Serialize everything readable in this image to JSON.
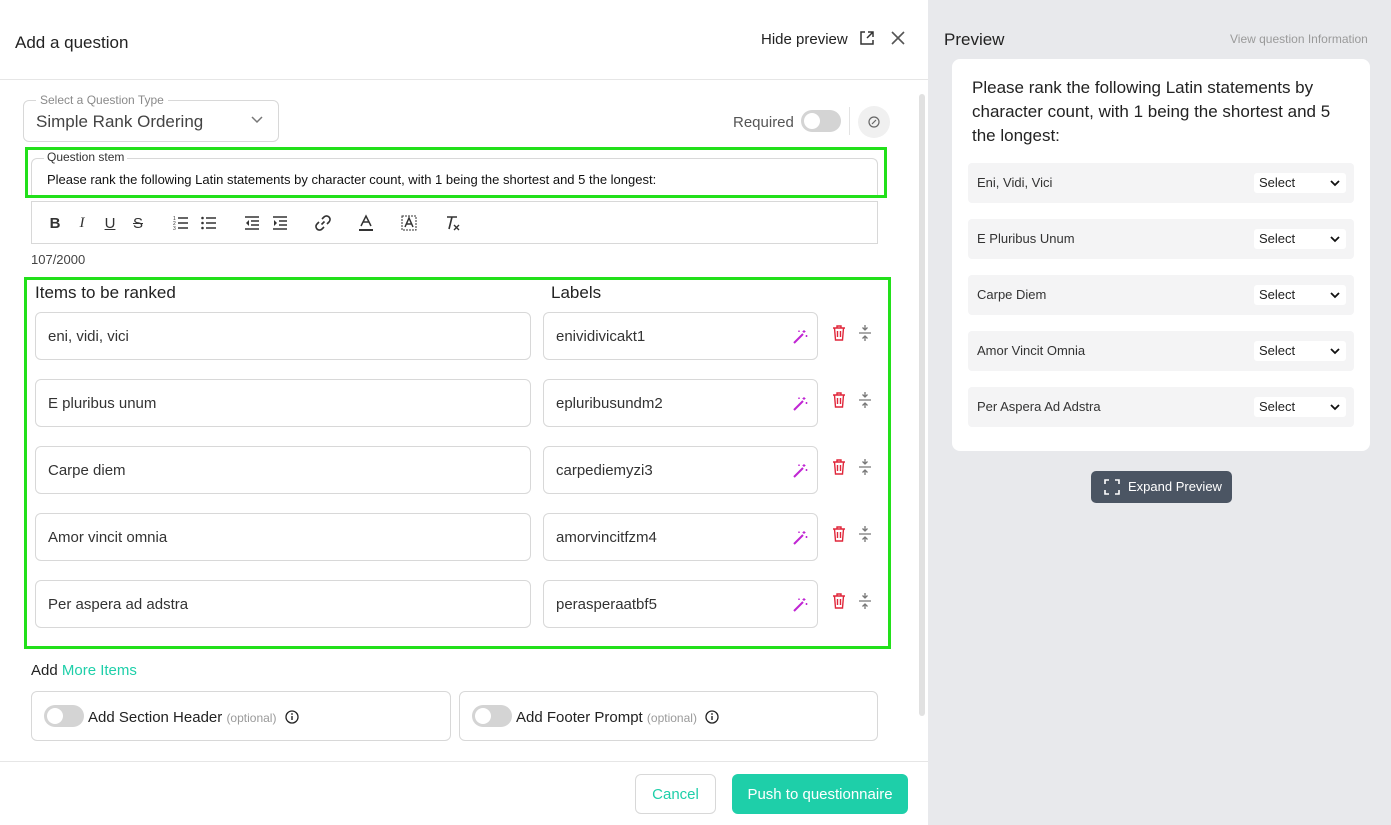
{
  "header": {
    "title": "Add a question",
    "hide_preview": "Hide preview"
  },
  "question_type": {
    "legend": "Select a Question Type",
    "value": "Simple Rank Ordering"
  },
  "required": {
    "label": "Required",
    "enabled": false
  },
  "stem": {
    "legend": "Question stem",
    "text": "Please rank the following Latin statements by character count, with 1 being the shortest and 5 the longest:",
    "counter": "107/2000"
  },
  "toolbar": {
    "icons": [
      "bold-icon",
      "italic-icon",
      "underline-icon",
      "strikethrough-icon",
      "ordered-list-icon",
      "bullet-list-icon",
      "outdent-icon",
      "indent-icon",
      "link-icon",
      "font-color-icon",
      "background-color-icon",
      "clear-format-icon"
    ]
  },
  "items": {
    "items_header": "Items to be ranked",
    "labels_header": "Labels",
    "rows": [
      {
        "item": "eni, vidi, vici",
        "label": "enividivicakt1"
      },
      {
        "item": "E pluribus unum",
        "label": "epluribusundm2"
      },
      {
        "item": "Carpe diem",
        "label": "carpediemyzi3"
      },
      {
        "item": "Amor vincit omnia",
        "label": "amorvincitfzm4"
      },
      {
        "item": "Per aspera ad adstra",
        "label": "perasperaatbf5"
      }
    ]
  },
  "add_more": {
    "prefix": "Add",
    "link": "More Items"
  },
  "options": {
    "section_header": "Add Section Header",
    "footer_prompt": "Add Footer Prompt",
    "optional": "(optional)"
  },
  "footer": {
    "cancel": "Cancel",
    "push": "Push to questionnaire"
  },
  "preview": {
    "title": "Preview",
    "view_info": "View question Information",
    "question": "Please rank the following Latin statements by character count, with 1 being the shortest and 5 the longest:",
    "select_placeholder": "Select",
    "rows": [
      "Eni, Vidi, Vici",
      "E Pluribus Unum",
      "Carpe Diem",
      "Amor Vincit Omnia",
      "Per Aspera Ad Adstra"
    ],
    "expand": "Expand Preview"
  },
  "colors": {
    "accent": "#1ecfa9",
    "highlight": "#22e01a",
    "delete": "#e0263a",
    "wand": "#c026d3"
  }
}
